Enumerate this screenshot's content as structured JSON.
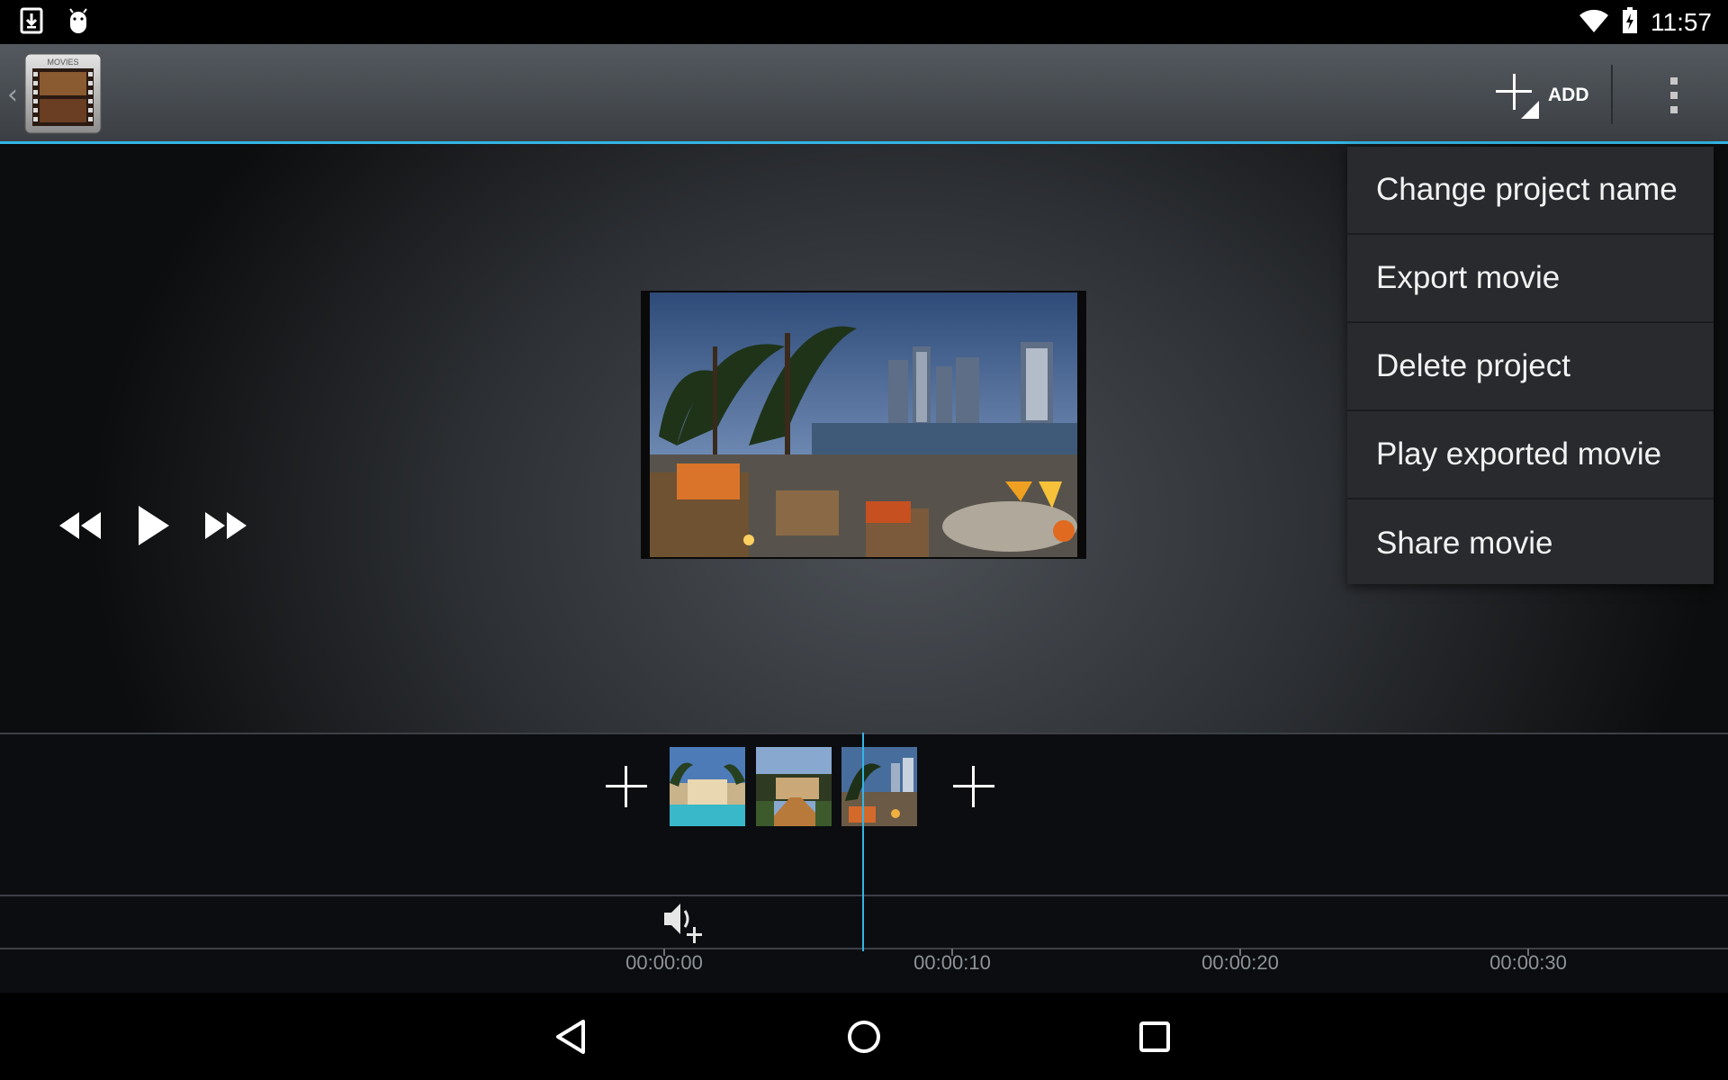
{
  "status_bar": {
    "time": "11:57",
    "icons": [
      "download-icon",
      "android-debug-icon",
      "wifi-icon",
      "battery-charging-icon"
    ]
  },
  "action_bar": {
    "app_icon_label": "MOVIES",
    "add_label": "ADD",
    "icons": [
      "up-caret-icon",
      "add-icon",
      "overflow-menu-icon"
    ]
  },
  "transport": {
    "icons": [
      "rewind-icon",
      "play-icon",
      "fast-forward-icon"
    ]
  },
  "overflow_menu": {
    "items": [
      {
        "label": "Change project name"
      },
      {
        "label": "Export movie"
      },
      {
        "label": "Delete project"
      },
      {
        "label": "Play exported movie"
      },
      {
        "label": "Share movie"
      }
    ]
  },
  "timeline": {
    "clips": [
      "clip-1",
      "clip-2",
      "clip-3"
    ],
    "ruler": [
      "00:00:00",
      "00:00:10",
      "00:00:20",
      "00:00:30"
    ]
  },
  "nav_bar": {
    "icons": [
      "back-icon",
      "home-icon",
      "recents-icon"
    ]
  },
  "colors": {
    "accent": "#33b5e5",
    "menu_bg": "#282a2e",
    "timeline_bg": "#0b0d10"
  }
}
